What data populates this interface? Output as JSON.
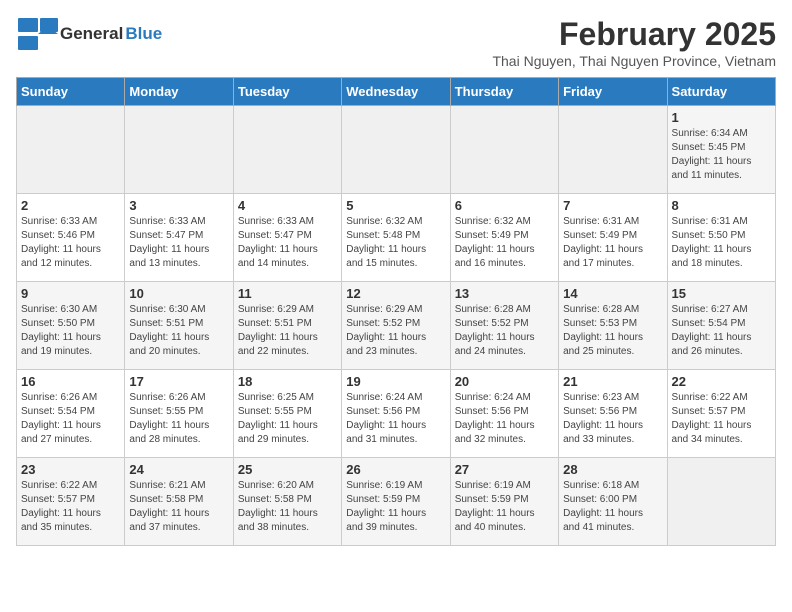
{
  "header": {
    "logo_general": "General",
    "logo_blue": "Blue",
    "month_title": "February 2025",
    "subtitle": "Thai Nguyen, Thai Nguyen Province, Vietnam"
  },
  "days_of_week": [
    "Sunday",
    "Monday",
    "Tuesday",
    "Wednesday",
    "Thursday",
    "Friday",
    "Saturday"
  ],
  "weeks": [
    [
      {
        "day": "",
        "info": ""
      },
      {
        "day": "",
        "info": ""
      },
      {
        "day": "",
        "info": ""
      },
      {
        "day": "",
        "info": ""
      },
      {
        "day": "",
        "info": ""
      },
      {
        "day": "",
        "info": ""
      },
      {
        "day": "1",
        "info": "Sunrise: 6:34 AM\nSunset: 5:45 PM\nDaylight: 11 hours\nand 11 minutes."
      }
    ],
    [
      {
        "day": "2",
        "info": "Sunrise: 6:33 AM\nSunset: 5:46 PM\nDaylight: 11 hours\nand 12 minutes."
      },
      {
        "day": "3",
        "info": "Sunrise: 6:33 AM\nSunset: 5:47 PM\nDaylight: 11 hours\nand 13 minutes."
      },
      {
        "day": "4",
        "info": "Sunrise: 6:33 AM\nSunset: 5:47 PM\nDaylight: 11 hours\nand 14 minutes."
      },
      {
        "day": "5",
        "info": "Sunrise: 6:32 AM\nSunset: 5:48 PM\nDaylight: 11 hours\nand 15 minutes."
      },
      {
        "day": "6",
        "info": "Sunrise: 6:32 AM\nSunset: 5:49 PM\nDaylight: 11 hours\nand 16 minutes."
      },
      {
        "day": "7",
        "info": "Sunrise: 6:31 AM\nSunset: 5:49 PM\nDaylight: 11 hours\nand 17 minutes."
      },
      {
        "day": "8",
        "info": "Sunrise: 6:31 AM\nSunset: 5:50 PM\nDaylight: 11 hours\nand 18 minutes."
      }
    ],
    [
      {
        "day": "9",
        "info": "Sunrise: 6:30 AM\nSunset: 5:50 PM\nDaylight: 11 hours\nand 19 minutes."
      },
      {
        "day": "10",
        "info": "Sunrise: 6:30 AM\nSunset: 5:51 PM\nDaylight: 11 hours\nand 20 minutes."
      },
      {
        "day": "11",
        "info": "Sunrise: 6:29 AM\nSunset: 5:51 PM\nDaylight: 11 hours\nand 22 minutes."
      },
      {
        "day": "12",
        "info": "Sunrise: 6:29 AM\nSunset: 5:52 PM\nDaylight: 11 hours\nand 23 minutes."
      },
      {
        "day": "13",
        "info": "Sunrise: 6:28 AM\nSunset: 5:52 PM\nDaylight: 11 hours\nand 24 minutes."
      },
      {
        "day": "14",
        "info": "Sunrise: 6:28 AM\nSunset: 5:53 PM\nDaylight: 11 hours\nand 25 minutes."
      },
      {
        "day": "15",
        "info": "Sunrise: 6:27 AM\nSunset: 5:54 PM\nDaylight: 11 hours\nand 26 minutes."
      }
    ],
    [
      {
        "day": "16",
        "info": "Sunrise: 6:26 AM\nSunset: 5:54 PM\nDaylight: 11 hours\nand 27 minutes."
      },
      {
        "day": "17",
        "info": "Sunrise: 6:26 AM\nSunset: 5:55 PM\nDaylight: 11 hours\nand 28 minutes."
      },
      {
        "day": "18",
        "info": "Sunrise: 6:25 AM\nSunset: 5:55 PM\nDaylight: 11 hours\nand 29 minutes."
      },
      {
        "day": "19",
        "info": "Sunrise: 6:24 AM\nSunset: 5:56 PM\nDaylight: 11 hours\nand 31 minutes."
      },
      {
        "day": "20",
        "info": "Sunrise: 6:24 AM\nSunset: 5:56 PM\nDaylight: 11 hours\nand 32 minutes."
      },
      {
        "day": "21",
        "info": "Sunrise: 6:23 AM\nSunset: 5:56 PM\nDaylight: 11 hours\nand 33 minutes."
      },
      {
        "day": "22",
        "info": "Sunrise: 6:22 AM\nSunset: 5:57 PM\nDaylight: 11 hours\nand 34 minutes."
      }
    ],
    [
      {
        "day": "23",
        "info": "Sunrise: 6:22 AM\nSunset: 5:57 PM\nDaylight: 11 hours\nand 35 minutes."
      },
      {
        "day": "24",
        "info": "Sunrise: 6:21 AM\nSunset: 5:58 PM\nDaylight: 11 hours\nand 37 minutes."
      },
      {
        "day": "25",
        "info": "Sunrise: 6:20 AM\nSunset: 5:58 PM\nDaylight: 11 hours\nand 38 minutes."
      },
      {
        "day": "26",
        "info": "Sunrise: 6:19 AM\nSunset: 5:59 PM\nDaylight: 11 hours\nand 39 minutes."
      },
      {
        "day": "27",
        "info": "Sunrise: 6:19 AM\nSunset: 5:59 PM\nDaylight: 11 hours\nand 40 minutes."
      },
      {
        "day": "28",
        "info": "Sunrise: 6:18 AM\nSunset: 6:00 PM\nDaylight: 11 hours\nand 41 minutes."
      },
      {
        "day": "",
        "info": ""
      }
    ]
  ]
}
